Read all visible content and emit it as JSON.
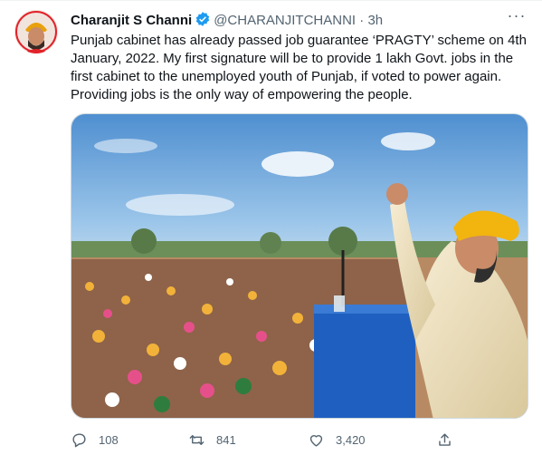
{
  "tweet": {
    "author_name": "Charanjit S Channi",
    "handle": "@CHARANJITCHANNI",
    "separator": "·",
    "time": "3h",
    "more_label": "···",
    "text": "Punjab cabinet has already passed job guarantee ‘PRAGTY’ scheme on 4th January, 2022. My first signature will be to provide 1 lakh Govt. jobs in the first cabinet to the unemployed youth of Punjab, if voted to power again. Providing jobs is the only way of empowering the people.",
    "media_alt_icon": "photo-rally-crowd-icon",
    "stats": {
      "replies": "108",
      "retweets": "841",
      "likes": "3,420"
    }
  },
  "colors": {
    "verified_blue": "#1d9bf0",
    "muted_text": "#536471",
    "turban_yellow": "#f2b40f",
    "sky_blue": "#6fa6d9",
    "podium_blue": "#1f5fbf"
  }
}
